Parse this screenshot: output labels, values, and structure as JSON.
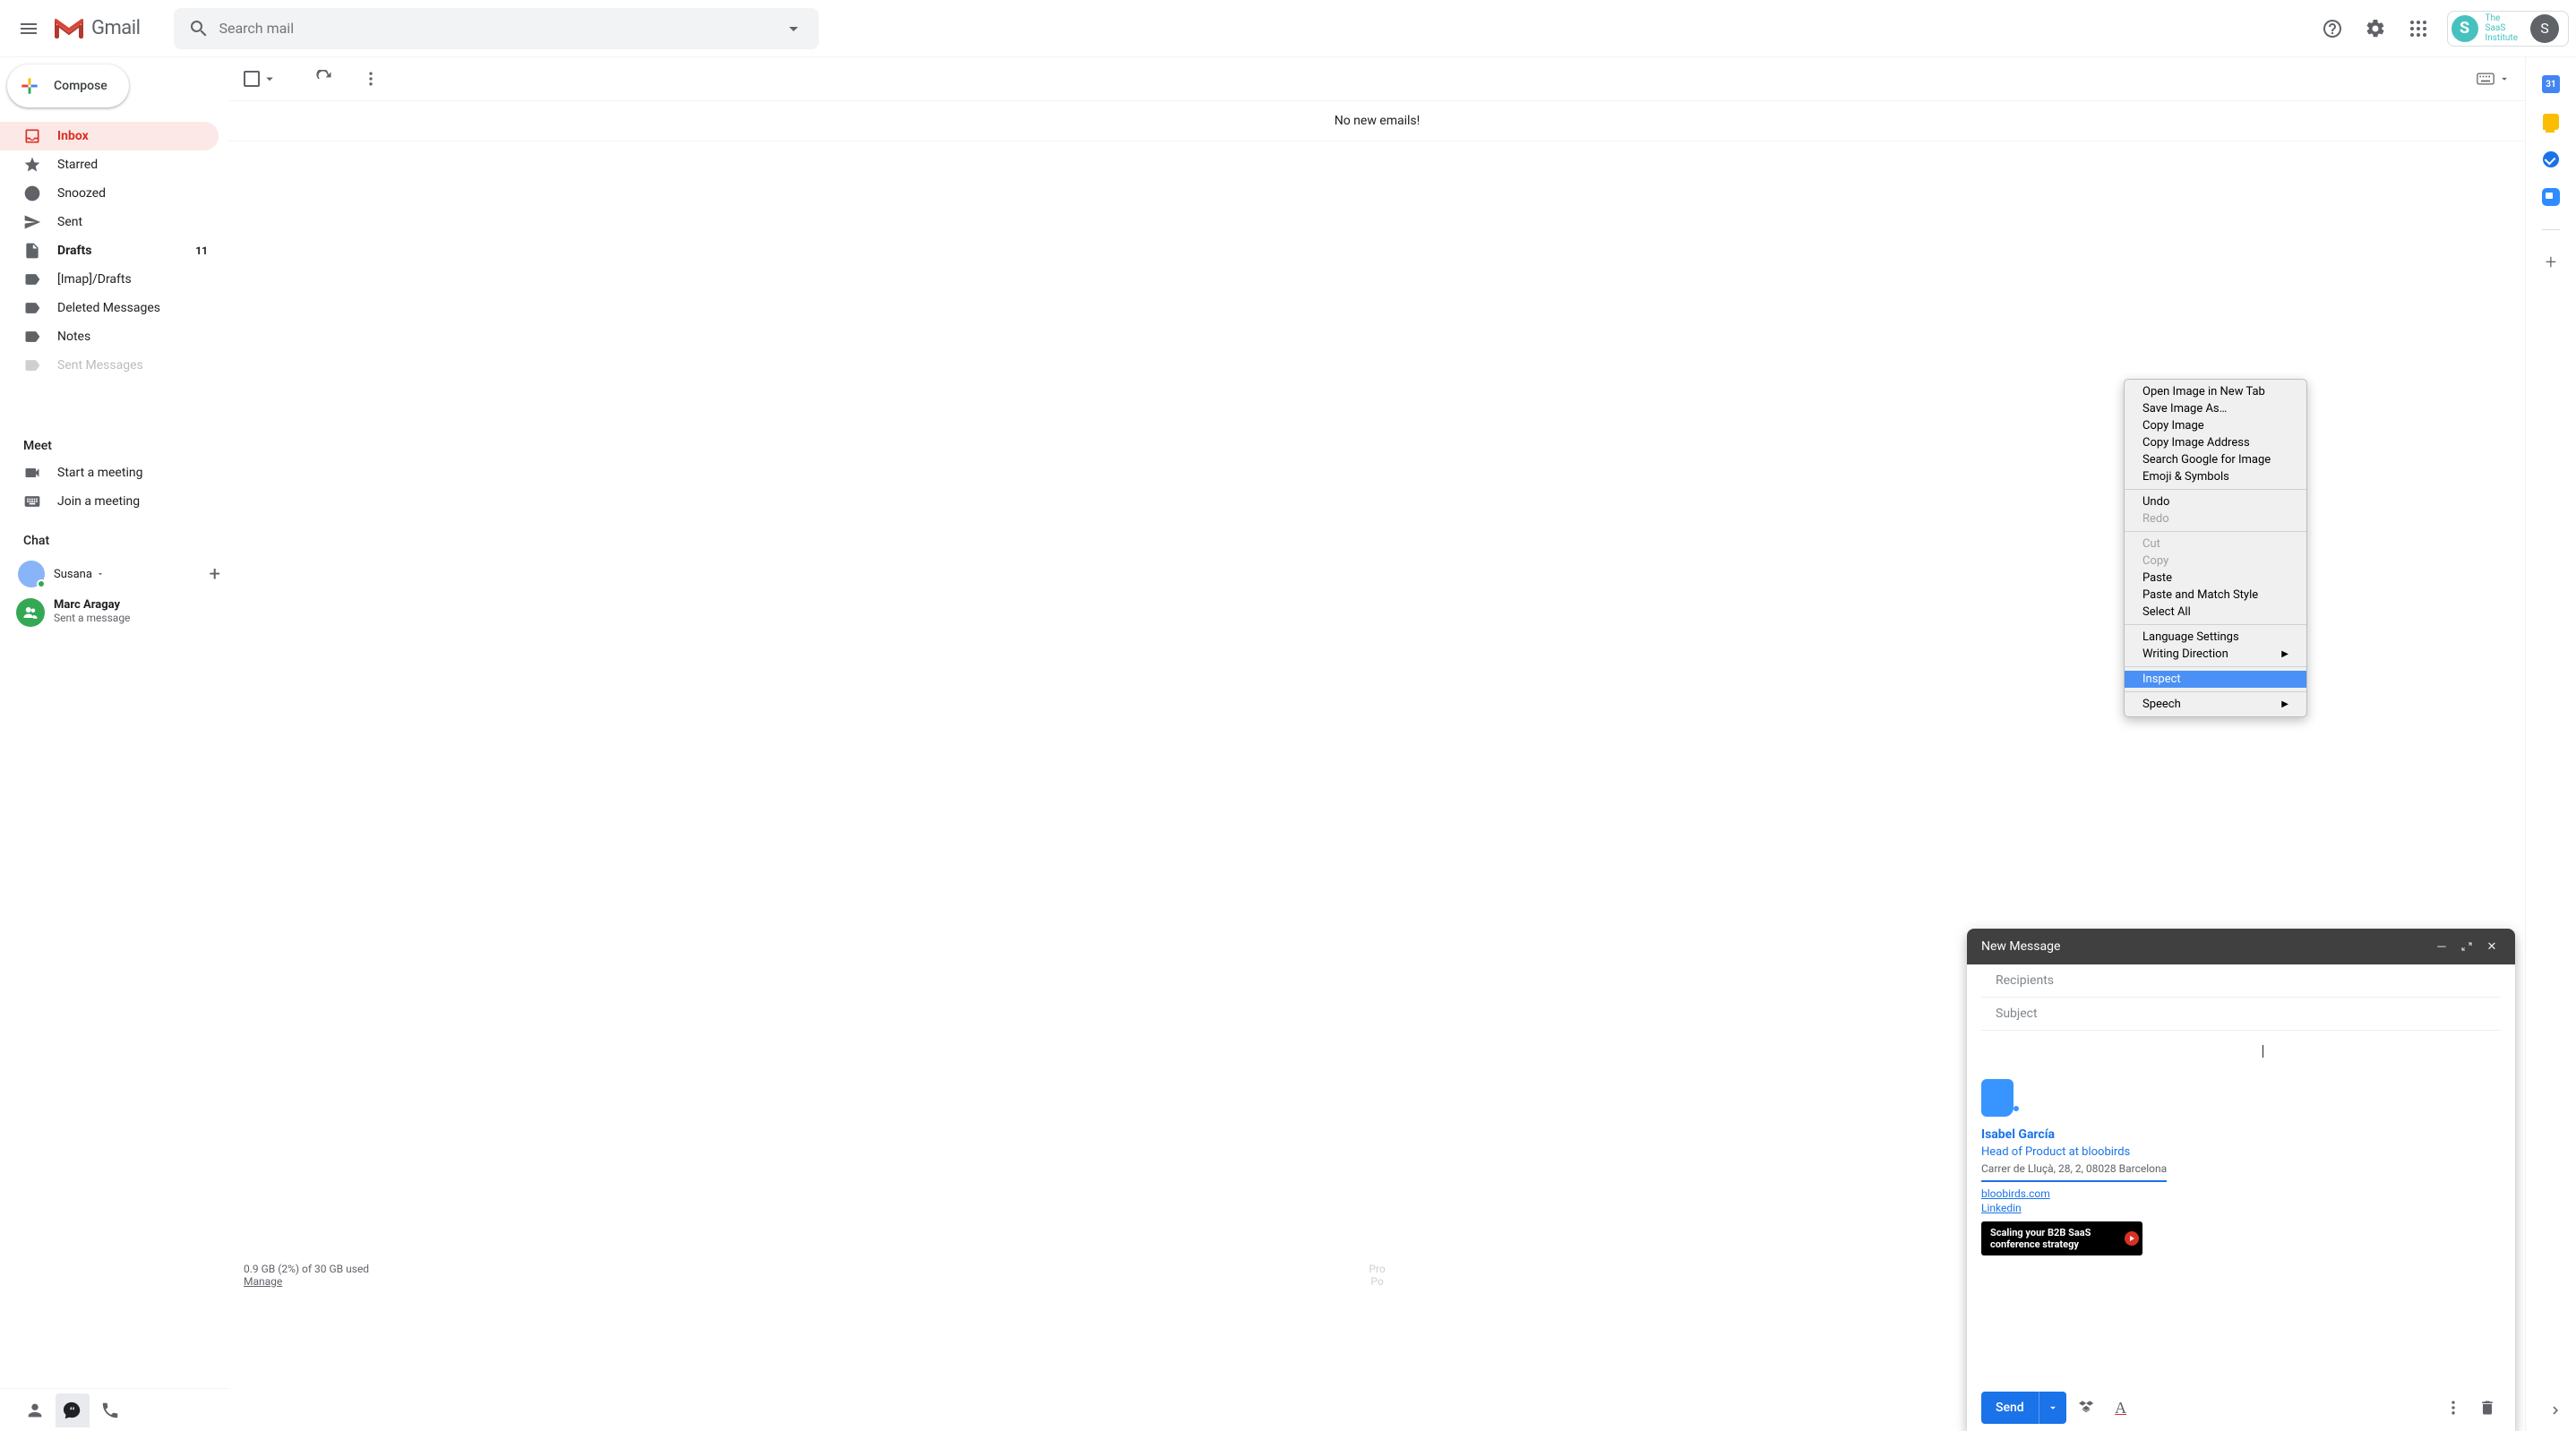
{
  "header": {
    "logo_text": "Gmail",
    "search_placeholder": "Search mail",
    "org_name": "The\nSaaS\nInstitute",
    "avatar_letter": "S"
  },
  "compose_btn": "Compose",
  "sidebar": {
    "items": [
      {
        "icon": "inbox",
        "label": "Inbox",
        "active": true
      },
      {
        "icon": "star",
        "label": "Starred"
      },
      {
        "icon": "clock",
        "label": "Snoozed"
      },
      {
        "icon": "send",
        "label": "Sent"
      },
      {
        "icon": "file",
        "label": "Drafts",
        "bold": true,
        "count": "11"
      },
      {
        "icon": "label",
        "label": "[Imap]/Drafts"
      },
      {
        "icon": "label",
        "label": "Deleted Messages"
      },
      {
        "icon": "label",
        "label": "Notes"
      },
      {
        "icon": "label",
        "label": "Sent Messages"
      }
    ],
    "meet_title": "Meet",
    "meet_items": [
      {
        "icon": "video",
        "label": "Start a meeting"
      },
      {
        "icon": "keyboard",
        "label": "Join a meeting"
      }
    ],
    "chat_title": "Chat",
    "chat_user": "Susana",
    "chat_contact_name": "Marc Aragay",
    "chat_contact_msg": "Sent a message"
  },
  "main": {
    "empty": "No new emails!",
    "storage": "0.9 GB (2%) of 30 GB used",
    "manage": "Manage",
    "hint1": "Pro",
    "hint2": "Po"
  },
  "right_panel": {
    "calendar_day": "31"
  },
  "compose": {
    "title": "New Message",
    "recipients": "Recipients",
    "subject": "Subject",
    "send": "Send",
    "signature": {
      "name": "Isabel García",
      "role": "Head of Product at bloobirds",
      "address": "Carrer de Lluçà, 28, 2, 08028 Barcelona",
      "link1": "bloobirds.com",
      "link2": "Linkedin",
      "banner": "Scaling your B2B SaaS conference strategy"
    }
  },
  "context_menu": {
    "groups": [
      [
        {
          "label": "Open Image in New Tab"
        },
        {
          "label": "Save Image As…"
        },
        {
          "label": "Copy Image"
        },
        {
          "label": "Copy Image Address"
        },
        {
          "label": "Search Google for Image"
        },
        {
          "label": "Emoji & Symbols"
        }
      ],
      [
        {
          "label": "Undo"
        },
        {
          "label": "Redo",
          "disabled": true
        }
      ],
      [
        {
          "label": "Cut",
          "disabled": true
        },
        {
          "label": "Copy",
          "disabled": true
        },
        {
          "label": "Paste"
        },
        {
          "label": "Paste and Match Style"
        },
        {
          "label": "Select All"
        }
      ],
      [
        {
          "label": "Language Settings"
        },
        {
          "label": "Writing Direction",
          "submenu": true
        }
      ],
      [
        {
          "label": "Inspect",
          "highlighted": true
        }
      ],
      [
        {
          "label": "Speech",
          "submenu": true
        }
      ]
    ]
  }
}
